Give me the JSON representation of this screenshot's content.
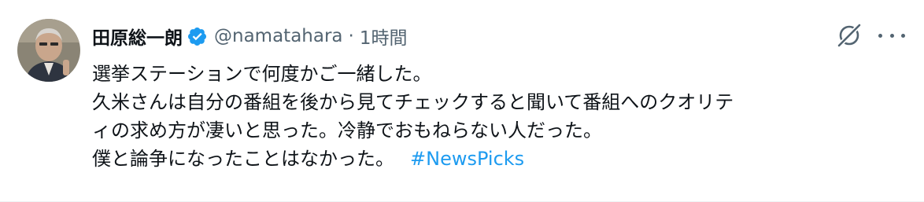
{
  "tweet": {
    "display_name": "田原総一朗",
    "handle": "@namatahara",
    "separator": "·",
    "time": "1時間",
    "verified_icon": "verified-badge-icon",
    "grok_icon": "grok-icon",
    "more_icon": "more-options-icon",
    "lines": [
      "選挙ステーションで何度かご一緒した。",
      "久米さんは自分の番組を後から見てチェックすると聞いて番組へのクオリテ",
      "ィの求め方が凄いと思った。冷静でおもねらない人だった。",
      "僕と論争になったことはなかった。"
    ],
    "hashtag": "#NewsPicks"
  },
  "colors": {
    "text_primary": "#0f1419",
    "text_secondary": "#536471",
    "accent": "#1d9bf0"
  }
}
